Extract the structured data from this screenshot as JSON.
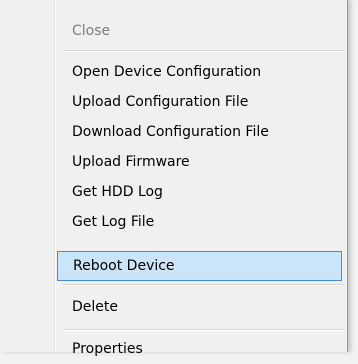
{
  "menu": {
    "items": [
      {
        "label": "Close",
        "state": "disabled"
      },
      {
        "label": "Open Device Configuration"
      },
      {
        "label": "Upload Configuration File"
      },
      {
        "label": "Download Configuration File"
      },
      {
        "label": "Upload Firmware"
      },
      {
        "label": "Get HDD Log"
      },
      {
        "label": "Get Log File"
      },
      {
        "label": "Reboot Device",
        "state": "hover"
      },
      {
        "label": "Delete"
      },
      {
        "label": "Properties"
      }
    ]
  },
  "colors": {
    "background": "#f0f0f0",
    "hover_fill": "#cce4f7",
    "hover_border": "#3f8fd8",
    "disabled_text": "#7d7d7d"
  }
}
